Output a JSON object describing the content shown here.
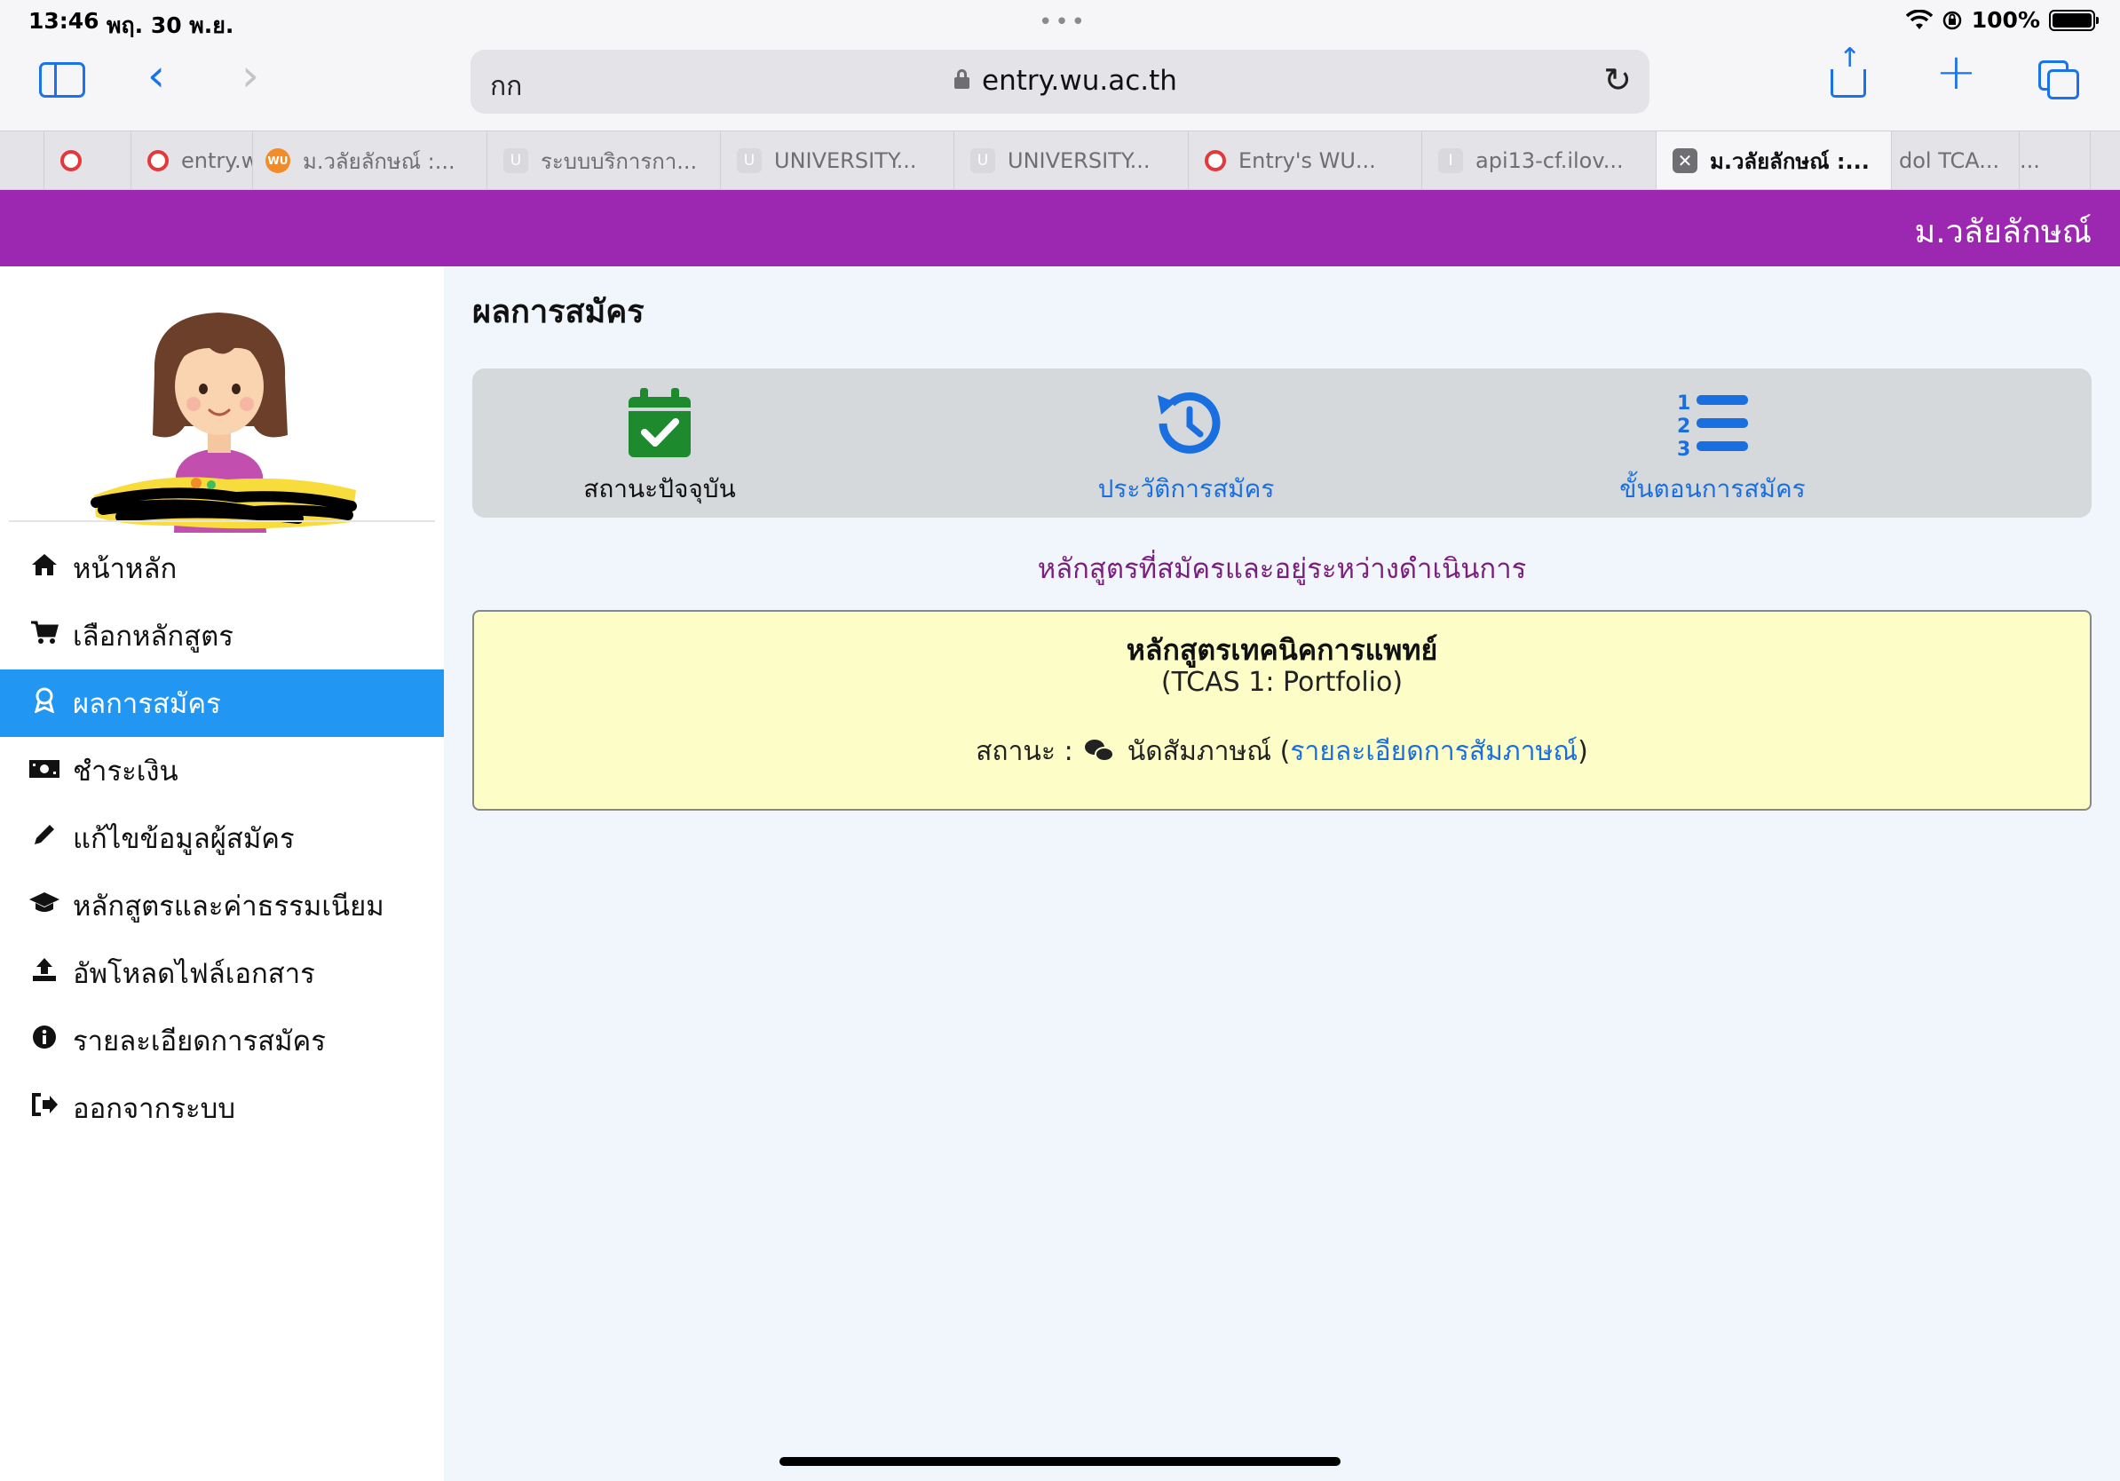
{
  "status_bar": {
    "time": "13:46",
    "date": "พฤ. 30 พ.ย.",
    "battery": "100%"
  },
  "browser": {
    "text_size_button": "กก",
    "url": "entry.wu.ac.th",
    "tabs": [
      {
        "label": "",
        "favicon": "red-circle-icon"
      },
      {
        "label": "entry.w",
        "favicon": "red-circle-icon"
      },
      {
        "label": "ม.วลัยลักษณ์ :...",
        "favicon": "wu-logo-icon",
        "favicon_text": "WU"
      },
      {
        "label": "ระบบบริการกา...",
        "favicon": "letter-u-icon",
        "favicon_text": "U"
      },
      {
        "label": "UNIVERSITY...",
        "favicon": "letter-u-icon",
        "favicon_text": "U"
      },
      {
        "label": "UNIVERSITY...",
        "favicon": "letter-u-icon",
        "favicon_text": "U"
      },
      {
        "label": "Entry's WU...",
        "favicon": "red-circle-icon"
      },
      {
        "label": "api13-cf.ilov...",
        "favicon": "letter-i-icon",
        "favicon_text": "I"
      },
      {
        "label": "ม.วลัยลักษณ์ :...",
        "favicon": "close-tab-icon",
        "favicon_text": "✕",
        "active": true
      },
      {
        "label": "dol TCA...",
        "favicon": ""
      },
      {
        "label": "...",
        "favicon": ""
      }
    ]
  },
  "site": {
    "brand": "ม.วลัยลักษณ์",
    "brand_color": "#9c27b0"
  },
  "sidebar": {
    "items": [
      {
        "label": "หน้าหลัก",
        "icon": "home-icon"
      },
      {
        "label": "เลือกหลักสูตร",
        "icon": "cart-icon"
      },
      {
        "label": "ผลการสมัคร",
        "icon": "award-icon",
        "active": true
      },
      {
        "label": "ชำระเงิน",
        "icon": "money-icon"
      },
      {
        "label": "แก้ไขข้อมูลผู้สมัคร",
        "icon": "pencil-icon"
      },
      {
        "label": "หลักสูตรและค่าธรรมเนียม",
        "icon": "graduation-cap-icon"
      },
      {
        "label": "อัพโหลดไฟล์เอกสาร",
        "icon": "upload-icon"
      },
      {
        "label": "รายละเอียดการสมัคร",
        "icon": "info-icon"
      },
      {
        "label": "ออกจากระบบ",
        "icon": "sign-out-icon"
      }
    ],
    "active_color": "#2196f3"
  },
  "main": {
    "title": "ผลการสมัคร",
    "nav_options": [
      {
        "label": "สถานะปัจจุบัน",
        "icon": "calendar-check-icon",
        "color": "#1e8a2e"
      },
      {
        "label": "ประวัติการสมัคร",
        "icon": "history-icon",
        "color": "#1a6fe0"
      },
      {
        "label": "ขั้นตอนการสมัคร",
        "icon": "ordered-list-icon",
        "color": "#1a6fe0"
      }
    ],
    "caption": "หลักสูตรที่สมัครและอยู่ระหว่างดำเนินการ",
    "program": {
      "name": "หลักสูตรเทคนิคการแพทย์",
      "round": "(TCAS 1: Portfolio)",
      "status_label": "สถานะ :",
      "status_value": "นัดสัมภาษณ์",
      "open_paren": "(",
      "link_text": "รายละเอียดการสัมภาษณ์",
      "close_paren": ")"
    }
  }
}
